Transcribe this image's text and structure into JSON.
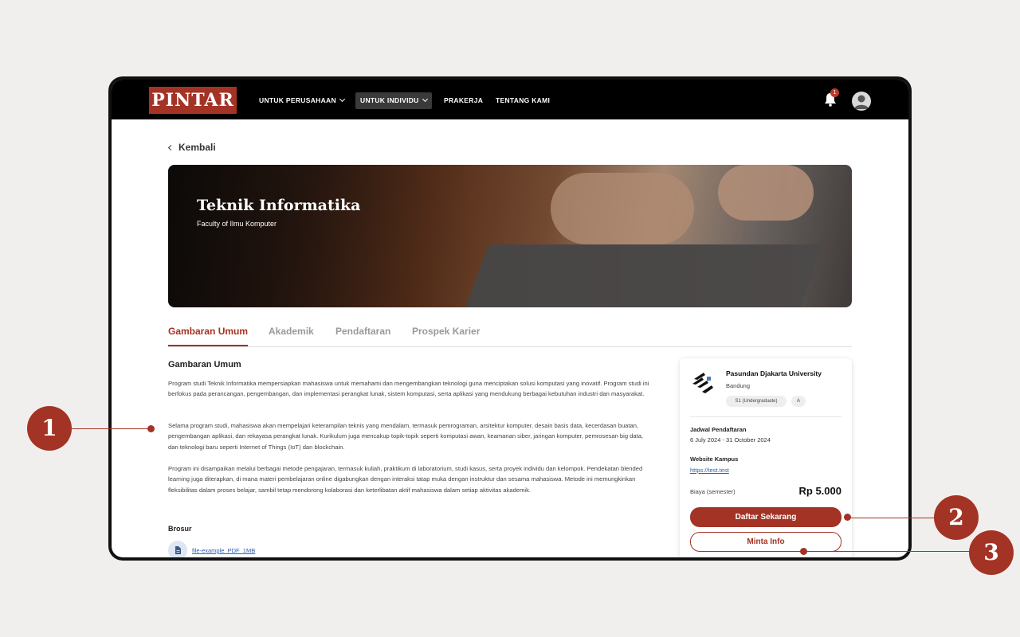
{
  "brand": {
    "logo_text": "PINTAR",
    "accent": "#a33325"
  },
  "nav": {
    "items": [
      {
        "label": "UNTUK PERUSAHAAN",
        "dropdown": true
      },
      {
        "label": "UNTUK INDIVIDU",
        "dropdown": true,
        "active": true
      },
      {
        "label": "PRAKERJA"
      },
      {
        "label": "TENTANG KAMI"
      }
    ],
    "notification_count": "1"
  },
  "back_label": "Kembali",
  "hero": {
    "title": "Teknik Informatika",
    "subtitle": "Faculty of Ilmu Komputer"
  },
  "tabs": [
    {
      "label": "Gambaran Umum",
      "active": true
    },
    {
      "label": "Akademik"
    },
    {
      "label": "Pendaftaran"
    },
    {
      "label": "Prospek Karier"
    }
  ],
  "overview": {
    "title": "Gambaran Umum",
    "paragraphs": [
      "Program studi Teknik Informatika mempersiapkan mahasiswa untuk memahami dan mengembangkan teknologi guna menciptakan solusi komputasi yang inovatif. Program studi ini berfokus pada perancangan, pengembangan, dan implementasi perangkat lunak, sistem komputasi, serta aplikasi yang mendukung berbagai kebutuhan industri dan masyarakat.",
      "Selama program studi, mahasiswa akan mempelajari keterampilan teknis yang mendalam, termasuk pemrograman, arsitektur komputer, desain basis data, kecerdasan buatan, pengembangan aplikasi, dan rekayasa perangkat lunak. Kurikulum juga mencakup topik-topik seperti komputasi awan, keamanan siber, jaringan komputer, pemrosesan big data, dan teknologi baru seperti Internet of Things (IoT) dan blockchain.",
      "Program ini disampaikan melalui berbagai metode pengajaran, termasuk kuliah, praktikum di laboratorium, studi kasus, serta proyek individu dan kelompok. Pendekatan blended learning juga diterapkan, di mana materi pembelajaran online digabungkan dengan interaksi tatap muka dengan instruktur dan sesama mahasiswa. Metode ini memungkinkan fleksibilitas dalam proses belajar, sambil tetap mendorong kolaborasi dan keterlibatan aktif mahasiswa dalam setiap aktivitas akademik."
    ],
    "brochure_title": "Brosur",
    "brochure_file": "file-example_PDF_1MB"
  },
  "card": {
    "university": "Pasundan Djakarta University",
    "city": "Bandung",
    "level": "S1 (Undergraduate)",
    "accreditation": "A",
    "schedule_label": "Jadwal Pendaftaran",
    "schedule_value": "6 July 2024 - 31 October 2024",
    "website_label": "Website Kampus",
    "website_value": "https://test.test",
    "fee_label": "Biaya (semester)",
    "fee_value": "Rp 5.000",
    "primary_button": "Daftar Sekarang",
    "secondary_button": "Minta Info"
  },
  "callouts": [
    "1",
    "2",
    "3"
  ]
}
